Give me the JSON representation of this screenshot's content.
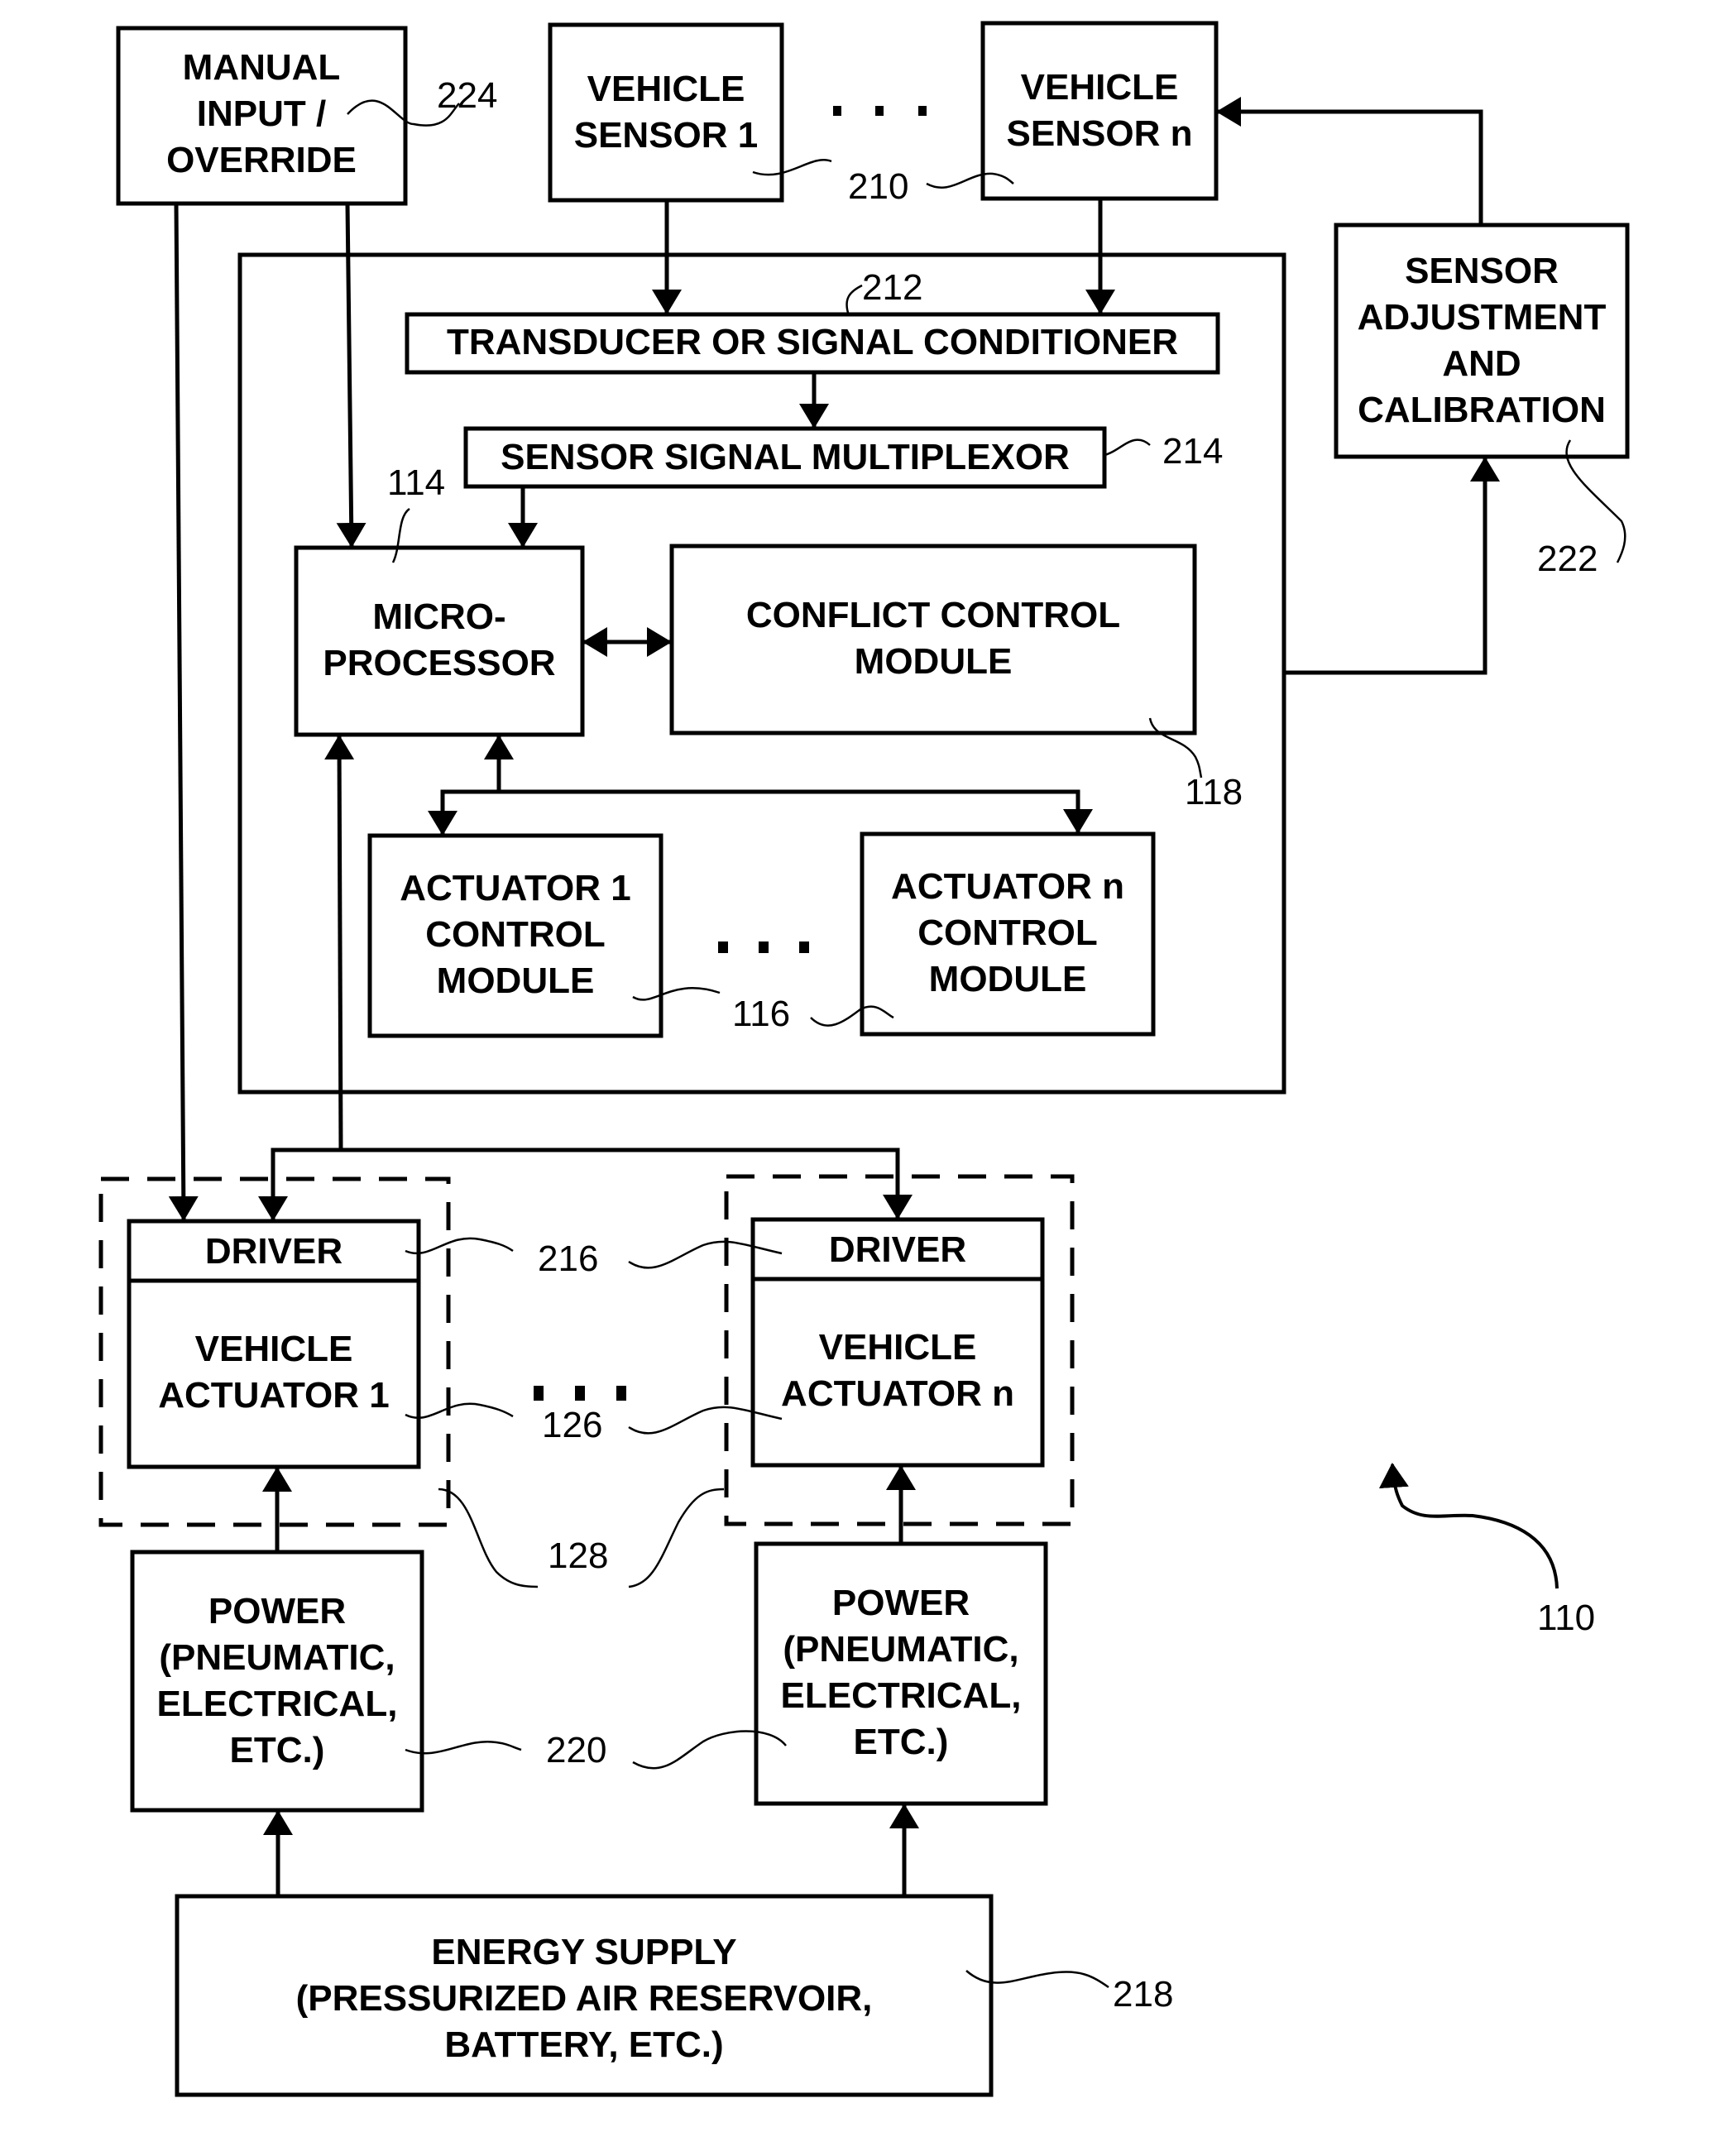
{
  "figure": {
    "type": "block-diagram",
    "reference": "110"
  },
  "blocks": {
    "manual_input": {
      "lines": [
        "MANUAL",
        "INPUT /",
        "OVERRIDE"
      ],
      "ref": "224"
    },
    "vehicle_sensor_1": {
      "lines": [
        "VEHICLE",
        "SENSOR 1"
      ]
    },
    "vehicle_sensor_n": {
      "lines": [
        "VEHICLE",
        "SENSOR n"
      ]
    },
    "vehicle_sensor_ref": "210",
    "sensor_adjustment": {
      "lines": [
        "SENSOR",
        "ADJUSTMENT",
        "AND",
        "CALIBRATION"
      ],
      "ref": "222"
    },
    "transducer": {
      "text": "TRANSDUCER OR SIGNAL CONDITIONER",
      "ref": "212"
    },
    "multiplexor": {
      "text": "SENSOR SIGNAL MULTIPLEXOR",
      "ref": "214"
    },
    "microprocessor": {
      "lines": [
        "MICRO-",
        "PROCESSOR"
      ],
      "ref": "114"
    },
    "conflict_control": {
      "lines": [
        "CONFLICT CONTROL",
        "MODULE"
      ],
      "ref": "118"
    },
    "actuator_1_control": {
      "lines": [
        "ACTUATOR 1",
        "CONTROL",
        "MODULE"
      ]
    },
    "actuator_n_control": {
      "lines": [
        "ACTUATOR n",
        "CONTROL",
        "MODULE"
      ]
    },
    "actuator_control_ref": "116",
    "driver_label": "DRIVER",
    "driver_ref": "216",
    "vehicle_actuator_1": {
      "lines": [
        "VEHICLE",
        "ACTUATOR 1"
      ]
    },
    "vehicle_actuator_n": {
      "lines": [
        "VEHICLE",
        "ACTUATOR n"
      ]
    },
    "vehicle_actuator_ref": "126",
    "actuator_assembly_ref": "128",
    "power": {
      "lines": [
        "POWER",
        "(PNEUMATIC,",
        "ELECTRICAL,",
        "ETC.)"
      ],
      "ref": "220"
    },
    "energy_supply": {
      "lines": [
        "ENERGY SUPPLY",
        "(PRESSURIZED AIR RESERVOIR,",
        "BATTERY, ETC.)"
      ],
      "ref": "218"
    }
  },
  "ellipsis": "..."
}
